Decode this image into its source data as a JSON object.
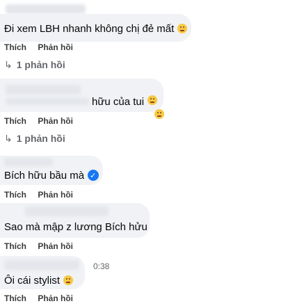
{
  "actions": {
    "like": "Thích",
    "reply": "Phản hồi"
  },
  "comments": [
    {
      "text": "Đi xem LBH nhanh không chị đẻ mất",
      "replies": "1 phản hồi"
    },
    {
      "text": "hữu của tui",
      "replies": "1 phản hồi"
    },
    {
      "text": "Bích hữu bầu mà"
    },
    {
      "text": "Sao mà mập z lương Bích hửu"
    },
    {
      "text": "Ôi cái stylist",
      "time": "0:38"
    }
  ]
}
